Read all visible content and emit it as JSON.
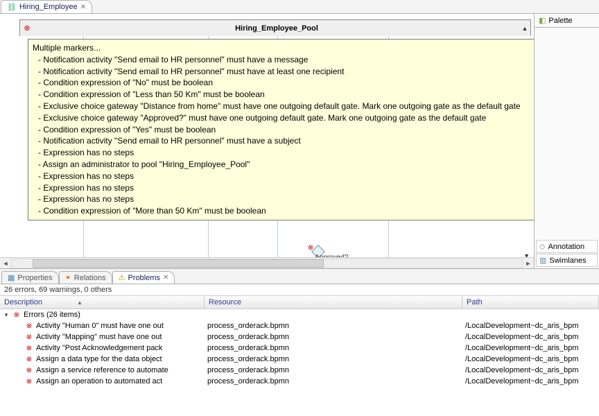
{
  "editor": {
    "tab_title": "Hiring_Employee",
    "pool_title": "Hiring_Employee_Pool",
    "approved_label": "Approved?"
  },
  "tooltip": {
    "header": "Multiple markers...",
    "lines": [
      "- Notification activity \"Send email to HR personnel\" must have a message",
      "- Notification activity \"Send email to HR personnel\" must have at least one recipient",
      "- Condition expression of \"No\" must be boolean",
      "- Condition expression of \"Less than 50 Km\" must be boolean",
      "- Exclusive choice gateway \"Distance from home\" must have one outgoing default gate. Mark one outgoing gate as the default gate",
      "- Exclusive choice gateway \"Approved?\" must have one outgoing default gate. Mark one outgoing gate as the default gate",
      "- Condition expression of \"Yes\" must be boolean",
      "- Notification activity \"Send email to HR personnel\" must have a subject",
      "- Expression has no steps",
      "- Assign an administrator to pool \"Hiring_Employee_Pool\"",
      "- Expression has no steps",
      "- Expression has no steps",
      "- Expression has no steps",
      "- Condition expression of \"More than 50 Km\" must be boolean"
    ]
  },
  "palette": {
    "title": "Palette",
    "items": [
      {
        "label": "Annotation",
        "icon": "◇"
      },
      {
        "label": "Swimlanes",
        "icon": "▥"
      }
    ]
  },
  "tabs": {
    "properties": "Properties",
    "relations": "Relations",
    "problems": "Problems"
  },
  "problems": {
    "summary": "26 errors, 69 warnings, 0 others",
    "columns": {
      "description": "Description",
      "resource": "Resource",
      "path": "Path"
    },
    "group_label": "Errors (26 items)",
    "rows": [
      {
        "desc": "Activity \"Human 0\" must have one out",
        "res": "process_orderack.bpmn",
        "path": "/LocalDevelopment~dc_aris_bpm"
      },
      {
        "desc": "Activity \"Mapping\" must have one out",
        "res": "process_orderack.bpmn",
        "path": "/LocalDevelopment~dc_aris_bpm"
      },
      {
        "desc": "Activity \"Post  Acknowledgement pack",
        "res": "process_orderack.bpmn",
        "path": "/LocalDevelopment~dc_aris_bpm"
      },
      {
        "desc": "Assign a data type for the data object",
        "res": "process_orderack.bpmn",
        "path": "/LocalDevelopment~dc_aris_bpm"
      },
      {
        "desc": "Assign a service reference to automate",
        "res": "process_orderack.bpmn",
        "path": "/LocalDevelopment~dc_aris_bpm"
      },
      {
        "desc": "Assign an operation to automated act",
        "res": "process_orderack.bpmn",
        "path": "/LocalDevelopment~dc_aris_bpm"
      }
    ]
  }
}
